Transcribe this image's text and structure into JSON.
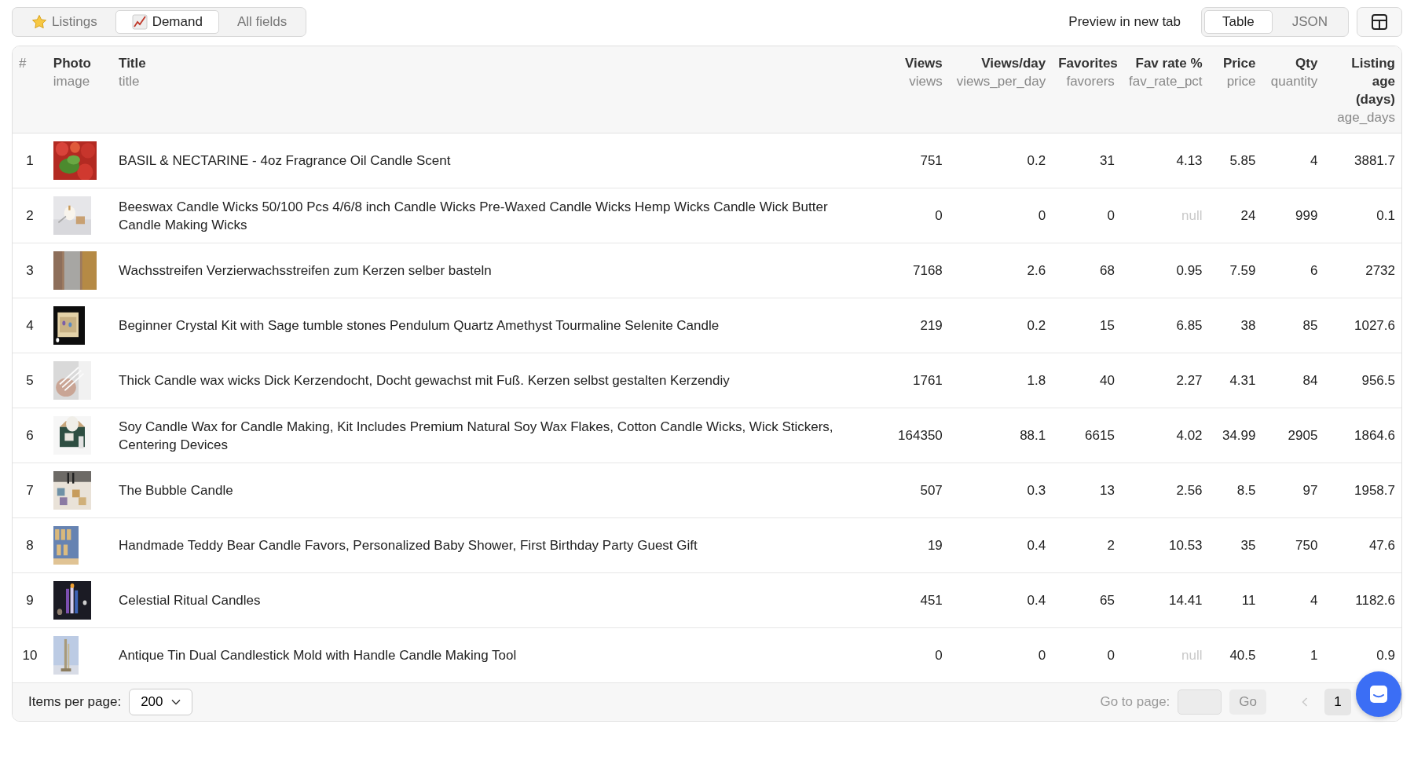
{
  "view_tabs": [
    {
      "label": "Listings",
      "selected": false
    },
    {
      "label": "Demand",
      "selected": true
    },
    {
      "label": "All fields",
      "selected": false
    }
  ],
  "preview_link": "Preview in new tab",
  "format_toggle": [
    {
      "label": "Table",
      "selected": true
    },
    {
      "label": "JSON",
      "selected": false
    }
  ],
  "table": {
    "columns": [
      {
        "label": "#"
      },
      {
        "label": "Photo",
        "field": "image"
      },
      {
        "label": "Title",
        "field": "title"
      },
      {
        "label": "Views",
        "field": "views"
      },
      {
        "label": "Views/day",
        "field": "views_per_day"
      },
      {
        "label": "Favorites",
        "field": "favorers"
      },
      {
        "label": "Fav rate %",
        "field": "fav_rate_pct"
      },
      {
        "label": "Price",
        "field": "price"
      },
      {
        "label": "Qty",
        "field": "quantity"
      },
      {
        "label": "Listing age (days)",
        "field": "age_days"
      }
    ],
    "rows": [
      {
        "index": "1",
        "title": "BASIL & NECTARINE - 4oz Fragrance Oil Candle Scent",
        "views": "751",
        "views_per_day": "0.2",
        "favorers": "31",
        "fav_rate_pct": "4.13",
        "fav_rate_missing": false,
        "price": "5.85",
        "quantity": "4",
        "age_days": "3881.7"
      },
      {
        "index": "2",
        "title": "Beeswax Candle Wicks 50/100 Pcs 4/6/8 inch Candle Wicks Pre-Waxed Candle Wicks Hemp Wicks Candle Wick Butter Candle Making Wicks",
        "views": "0",
        "views_per_day": "0",
        "favorers": "0",
        "fav_rate_pct": "null",
        "fav_rate_missing": true,
        "price": "24",
        "quantity": "999",
        "age_days": "0.1"
      },
      {
        "index": "3",
        "title": "Wachsstreifen Verzierwachsstreifen zum Kerzen selber basteln",
        "views": "7168",
        "views_per_day": "2.6",
        "favorers": "68",
        "fav_rate_pct": "0.95",
        "fav_rate_missing": false,
        "price": "7.59",
        "quantity": "6",
        "age_days": "2732"
      },
      {
        "index": "4",
        "title": "Beginner Crystal Kit with Sage tumble stones Pendulum Quartz Amethyst Tourmaline Selenite Candle",
        "views": "219",
        "views_per_day": "0.2",
        "favorers": "15",
        "fav_rate_pct": "6.85",
        "fav_rate_missing": false,
        "price": "38",
        "quantity": "85",
        "age_days": "1027.6"
      },
      {
        "index": "5",
        "title": "Thick Candle wax wicks Dick Kerzendocht, Docht gewachst mit Fuß. Kerzen selbst gestalten Kerzendiy",
        "views": "1761",
        "views_per_day": "1.8",
        "favorers": "40",
        "fav_rate_pct": "2.27",
        "fav_rate_missing": false,
        "price": "4.31",
        "quantity": "84",
        "age_days": "956.5"
      },
      {
        "index": "6",
        "title": "Soy Candle Wax for Candle Making, Kit Includes Premium Natural Soy Wax Flakes, Cotton Candle Wicks, Wick Stickers, Centering Devices",
        "views": "164350",
        "views_per_day": "88.1",
        "favorers": "6615",
        "fav_rate_pct": "4.02",
        "fav_rate_missing": false,
        "price": "34.99",
        "quantity": "2905",
        "age_days": "1864.6"
      },
      {
        "index": "7",
        "title": "The Bubble Candle",
        "views": "507",
        "views_per_day": "0.3",
        "favorers": "13",
        "fav_rate_pct": "2.56",
        "fav_rate_missing": false,
        "price": "8.5",
        "quantity": "97",
        "age_days": "1958.7"
      },
      {
        "index": "8",
        "title": "Handmade Teddy Bear Candle Favors, Personalized Baby Shower, First Birthday Party Guest Gift",
        "views": "19",
        "views_per_day": "0.4",
        "favorers": "2",
        "fav_rate_pct": "10.53",
        "fav_rate_missing": false,
        "price": "35",
        "quantity": "750",
        "age_days": "47.6"
      },
      {
        "index": "9",
        "title": "Celestial Ritual Candles",
        "views": "451",
        "views_per_day": "0.4",
        "favorers": "65",
        "fav_rate_pct": "14.41",
        "fav_rate_missing": false,
        "price": "11",
        "quantity": "4",
        "age_days": "1182.6"
      },
      {
        "index": "10",
        "title": "Antique Tin Dual Candlestick Mold with Handle Candle Making Tool",
        "views": "0",
        "views_per_day": "0",
        "favorers": "0",
        "fav_rate_pct": "null",
        "fav_rate_missing": true,
        "price": "40.5",
        "quantity": "1",
        "age_days": "0.9"
      }
    ]
  },
  "footer": {
    "items_per_page_label": "Items per page:",
    "items_per_page": "200",
    "go_to_page_label": "Go to page:",
    "go_button": "Go",
    "current_page": "1"
  }
}
